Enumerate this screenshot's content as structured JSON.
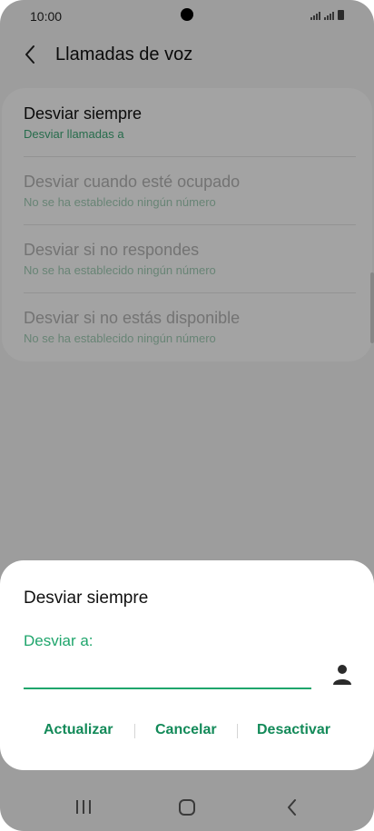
{
  "status_bar": {
    "time": "10:00"
  },
  "app_bar": {
    "title": "Llamadas de voz"
  },
  "settings": {
    "items": [
      {
        "title": "Desviar siempre",
        "subtitle": "Desviar llamadas a"
      },
      {
        "title": "Desviar cuando esté ocupado",
        "subtitle": "No se ha establecido ningún número"
      },
      {
        "title": "Desviar si no respondes",
        "subtitle": "No se ha establecido ningún número"
      },
      {
        "title": "Desviar si no estás disponible",
        "subtitle": "No se ha establecido ningún número"
      }
    ]
  },
  "dialog": {
    "title": "Desviar siempre",
    "field_label": "Desviar a:",
    "field_value": "",
    "buttons": {
      "update": "Actualizar",
      "cancel": "Cancelar",
      "deactivate": "Desactivar"
    }
  },
  "colors": {
    "accent": "#1fa56c",
    "accent_dark": "#138a59"
  }
}
